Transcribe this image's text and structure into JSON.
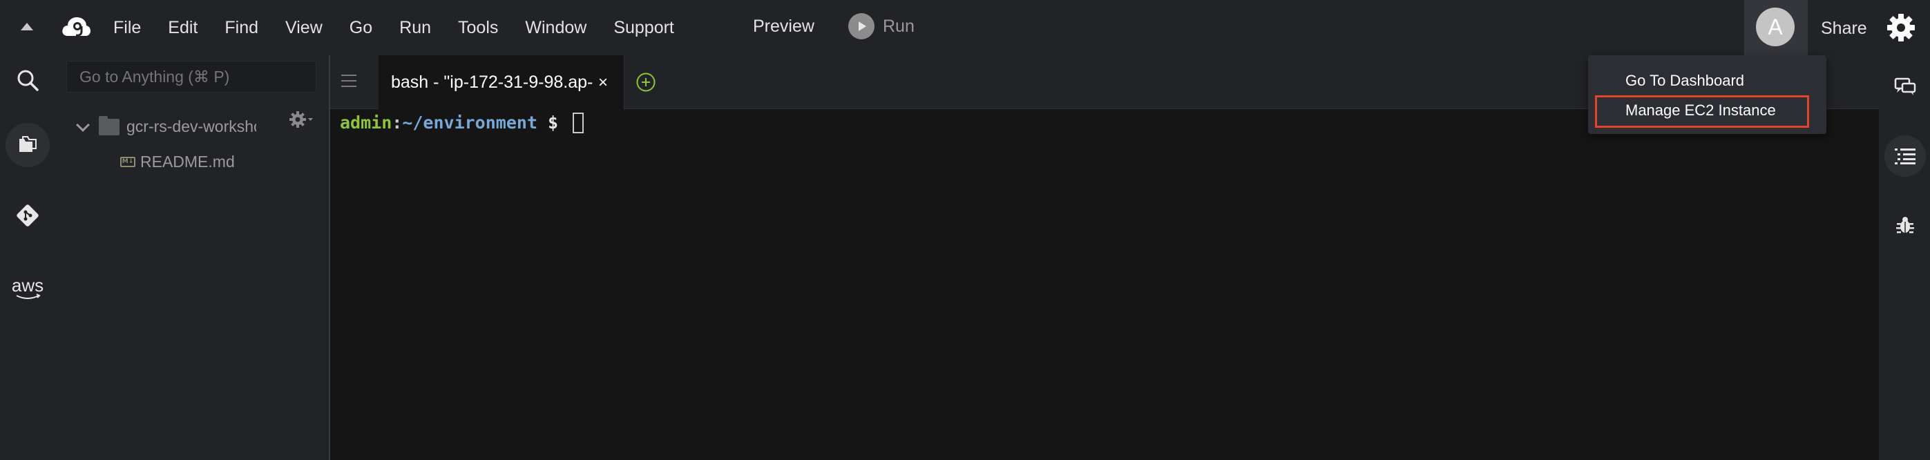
{
  "menubar": {
    "items": [
      "File",
      "Edit",
      "Find",
      "View",
      "Go",
      "Run",
      "Tools",
      "Window",
      "Support"
    ],
    "preview_label": "Preview",
    "run_label": "Run",
    "avatar_letter": "A",
    "share_label": "Share"
  },
  "left_rail": {
    "icons": [
      "search-icon",
      "environment-files-icon",
      "source-control-icon",
      "aws-icon"
    ],
    "aws_label": "aws"
  },
  "file_tree": {
    "search_placeholder": "Go to Anything (⌘ P)",
    "root_folder": "gcr-rs-dev-workshc",
    "file": "README.md",
    "file_badge": "M↓"
  },
  "editor": {
    "tab_label": "bash - \"ip-172-31-9-98.ap-",
    "tab_close": "×",
    "terminal": {
      "user": "admin",
      "colon": ":",
      "path": "~/environment",
      "dollar": " $ "
    }
  },
  "dropdown": {
    "items": [
      "Go To Dashboard",
      "Manage EC2 Instance"
    ],
    "highlighted_item": "Manage EC2 Instance",
    "highlight_color": "#e2432e"
  },
  "right_rail": {
    "icons": [
      "collaborate-chat-icon",
      "outline-icon",
      "debugger-icon"
    ]
  },
  "colors": {
    "background": "#222326",
    "terminal_bg": "#151515",
    "prompt_user": "#8fc23d",
    "prompt_path": "#78a9d6"
  }
}
